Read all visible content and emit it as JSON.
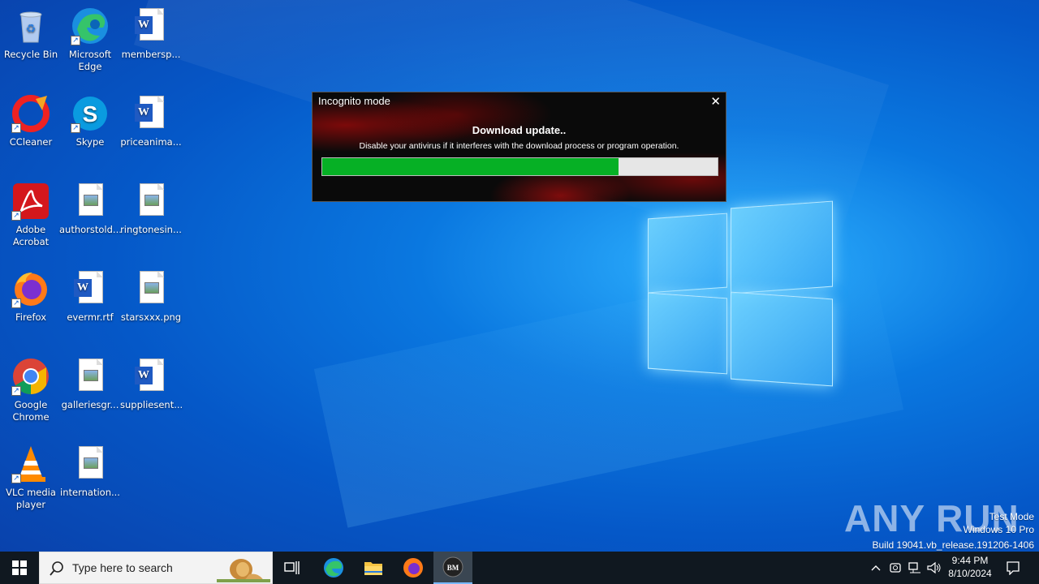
{
  "desktop": {
    "icons": [
      {
        "label": "Recycle Bin"
      },
      {
        "label": "Microsoft Edge"
      },
      {
        "label": "membersp..."
      },
      {
        "label": "CCleaner"
      },
      {
        "label": "Skype"
      },
      {
        "label": "priceanima..."
      },
      {
        "label": "Adobe Acrobat"
      },
      {
        "label": "authorstold..."
      },
      {
        "label": "ringtonesin..."
      },
      {
        "label": "Firefox"
      },
      {
        "label": "evermr.rtf"
      },
      {
        "label": "starsxxx.png"
      },
      {
        "label": "Google Chrome"
      },
      {
        "label": "galleriesgr..."
      },
      {
        "label": "suppliesent..."
      },
      {
        "label": "VLC media player"
      },
      {
        "label": "internation..."
      }
    ]
  },
  "dialog": {
    "title": "Incognito mode",
    "close_symbol": "✕",
    "heading": "Download update..",
    "message": "Disable your antivirus if it interferes with the download process or program operation.",
    "progress_fraction": 0.75,
    "progress_color": "#06b025"
  },
  "watermark": {
    "brand": "ANY RUN",
    "line1": "Test Mode",
    "line2": "Windows 10 Pro",
    "line3": "Build 19041.vb_release.191206-1406"
  },
  "taskbar": {
    "search_placeholder": "Type here to search",
    "pinned": [
      "task-view-icon",
      "edge-icon",
      "file-explorer-icon",
      "firefox-icon",
      "bm-app-icon"
    ],
    "bm_label": "BM",
    "clock_time": "9:44 PM",
    "clock_date": "8/10/2024"
  }
}
